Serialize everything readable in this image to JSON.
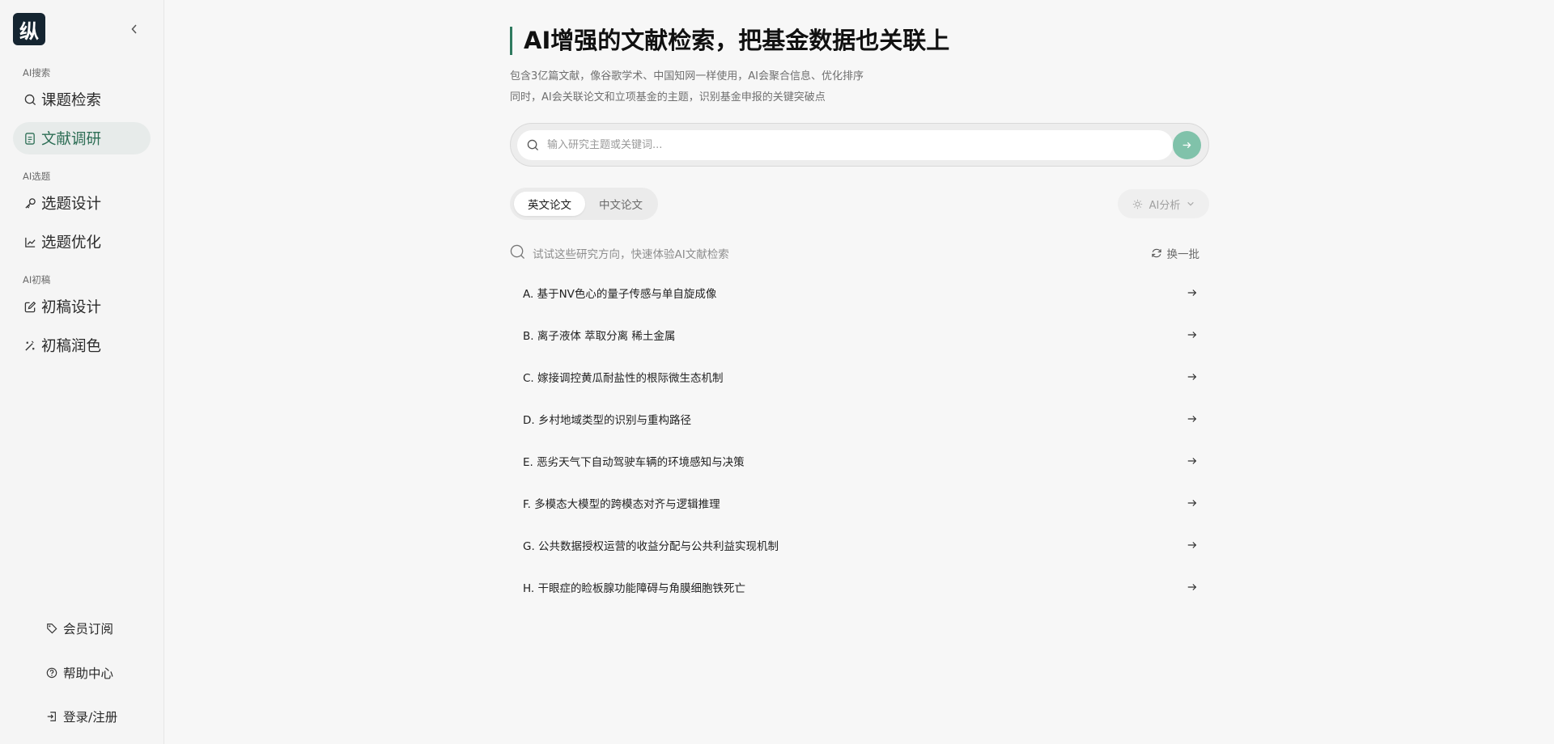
{
  "logo": {
    "text": "纵"
  },
  "sidebar": {
    "sections": [
      {
        "label": "AI搜索",
        "items": [
          {
            "label": "课题检索",
            "icon": "search-icon"
          },
          {
            "label": "文献调研",
            "icon": "document-icon",
            "active": true
          }
        ]
      },
      {
        "label": "AI选题",
        "items": [
          {
            "label": "选题设计",
            "icon": "key-icon"
          },
          {
            "label": "选题优化",
            "icon": "line-chart-icon"
          }
        ]
      },
      {
        "label": "AI初稿",
        "items": [
          {
            "label": "初稿设计",
            "icon": "edit-icon"
          },
          {
            "label": "初稿润色",
            "icon": "magic-wand-icon"
          }
        ]
      }
    ],
    "bottom": [
      {
        "label": "会员订阅",
        "icon": "tag-icon"
      },
      {
        "label": "帮助中心",
        "icon": "help-circle-icon"
      },
      {
        "label": "登录/注册",
        "icon": "login-icon"
      }
    ]
  },
  "main": {
    "title": "AI增强的文献检索，把基金数据也关联上",
    "subtitle_line1": "包含3亿篇文献，像谷歌学术、中国知网一样使用，AI会聚合信息、优化排序",
    "subtitle_line2": "同时，AI会关联论文和立项基金的主题，识别基金申报的关键突破点",
    "search": {
      "placeholder": "输入研究主题或关键词...",
      "value": ""
    },
    "tabs": [
      {
        "label": "英文论文",
        "active": true
      },
      {
        "label": "中文论文",
        "active": false
      }
    ],
    "ai_button": {
      "label": "AI分析"
    },
    "hint": "试试这些研究方向，快速体验AI文献检索",
    "refresh_label": "换一批",
    "topics": [
      "A. 基于NV色心的量子传感与单自旋成像",
      "B. 离子液体 萃取分离 稀土金属",
      "C. 嫁接调控黄瓜耐盐性的根际微生态机制",
      "D. 乡村地域类型的识别与重构路径",
      "E. 恶劣天气下自动驾驶车辆的环境感知与决策",
      "F. 多模态大模型的跨模态对齐与逻辑推理",
      "G. 公共数据授权运营的收益分配与公共利益实现机制",
      "H. 干眼症的睑板腺功能障碍与角膜细胞铁死亡"
    ]
  },
  "colors": {
    "accent": "#2f7a5f",
    "submit_button": "#80c2aa",
    "active_nav_bg": "#e7ebea",
    "logo_bg": "#152531"
  }
}
